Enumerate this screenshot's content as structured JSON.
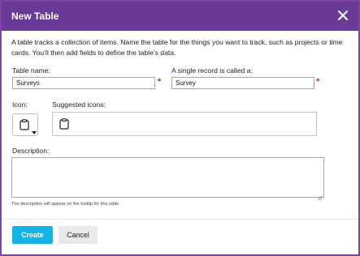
{
  "dialog": {
    "title": "New Table",
    "intro": "A table tracks a collection of items. Name the table for the things you want to track, such as projects or time cards. You’ll then add fields to define the table’s data."
  },
  "fields": {
    "table_name_label": "Table name:",
    "table_name_value": "Surveys",
    "record_label": "A single record is called a:",
    "record_value": "Survey",
    "required_marker": "*",
    "icon_label": "Icon:",
    "suggested_label": "Suggested icons:",
    "description_label": "Description:",
    "description_value": "",
    "description_hint": "The description will appear on the tooltip for this table"
  },
  "icons": {
    "selected": "clipboard-icon",
    "suggested": [
      "clipboard-icon"
    ]
  },
  "buttons": {
    "create": "Create",
    "cancel": "Cancel"
  },
  "colors": {
    "title_bar": "#6a3a97",
    "frame": "#7a45a6",
    "primary_button": "#12b3e6",
    "required": "#e02020"
  }
}
